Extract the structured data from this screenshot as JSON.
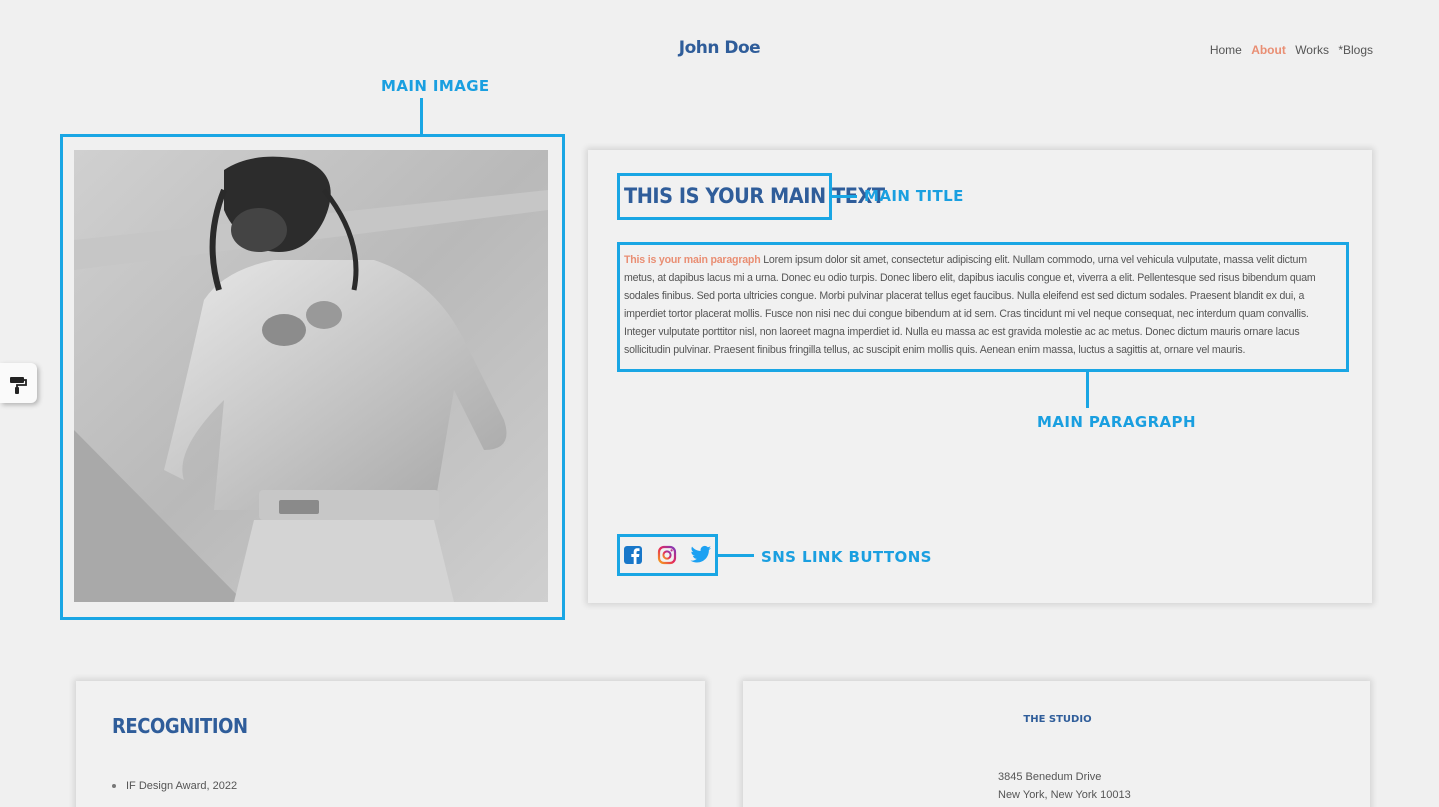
{
  "header": {
    "site_title": "John Doe"
  },
  "nav": {
    "items": [
      "Home",
      "About",
      "Works",
      "*Blogs"
    ],
    "active": "About"
  },
  "annotations": {
    "main_image": "MAIN IMAGE",
    "main_title": "MAIN TITLE",
    "main_paragraph": "MAIN PARAGRAPH",
    "sns_buttons": "SNS LINK BUTTONS"
  },
  "main": {
    "title": "THIS IS YOUR MAIN TEXT",
    "paragraph_lead": "This is your main paragraph",
    "paragraph_body": " Lorem ipsum dolor sit amet, consectetur adipiscing elit. Nullam commodo, urna vel vehicula vulputate, massa velit dictum metus, at dapibus lacus mi a urna. Donec eu odio turpis. Donec libero elit, dapibus iaculis congue et, viverra a elit. Pellentesque sed risus bibendum quam sodales finibus. Sed porta ultricies congue. Morbi pulvinar placerat tellus eget faucibus. Nulla eleifend est sed dictum sodales. Praesent blandit ex dui, a imperdiet tortor placerat mollis. Fusce non nisi nec dui congue bibendum at id sem. Cras tincidunt mi vel neque consequat, nec interdum quam convallis. Integer vulputate porttitor nisl, non laoreet magna imperdiet id. Nulla eu massa ac est gravida molestie ac ac metus. Donec dictum mauris ornare lacus sollicitudin pulvinar. Praesent finibus fringilla tellus, ac suscipit enim mollis quis. Aenean enim massa, luctus a sagittis at, ornare vel mauris."
  },
  "sns": {
    "icons": [
      "facebook-icon",
      "instagram-icon",
      "twitter-icon"
    ]
  },
  "recognition": {
    "title": "RECOGNITION",
    "items": [
      "IF Design Award, 2022"
    ]
  },
  "studio": {
    "title": "THE STUDIO",
    "address_line1": "3845 Benedum Drive",
    "address_line2": "New York, New York 10013"
  },
  "colors": {
    "accent": "#e98e73",
    "title_blue": "#2f5d9a",
    "annotation_blue": "#1aa6e4"
  }
}
